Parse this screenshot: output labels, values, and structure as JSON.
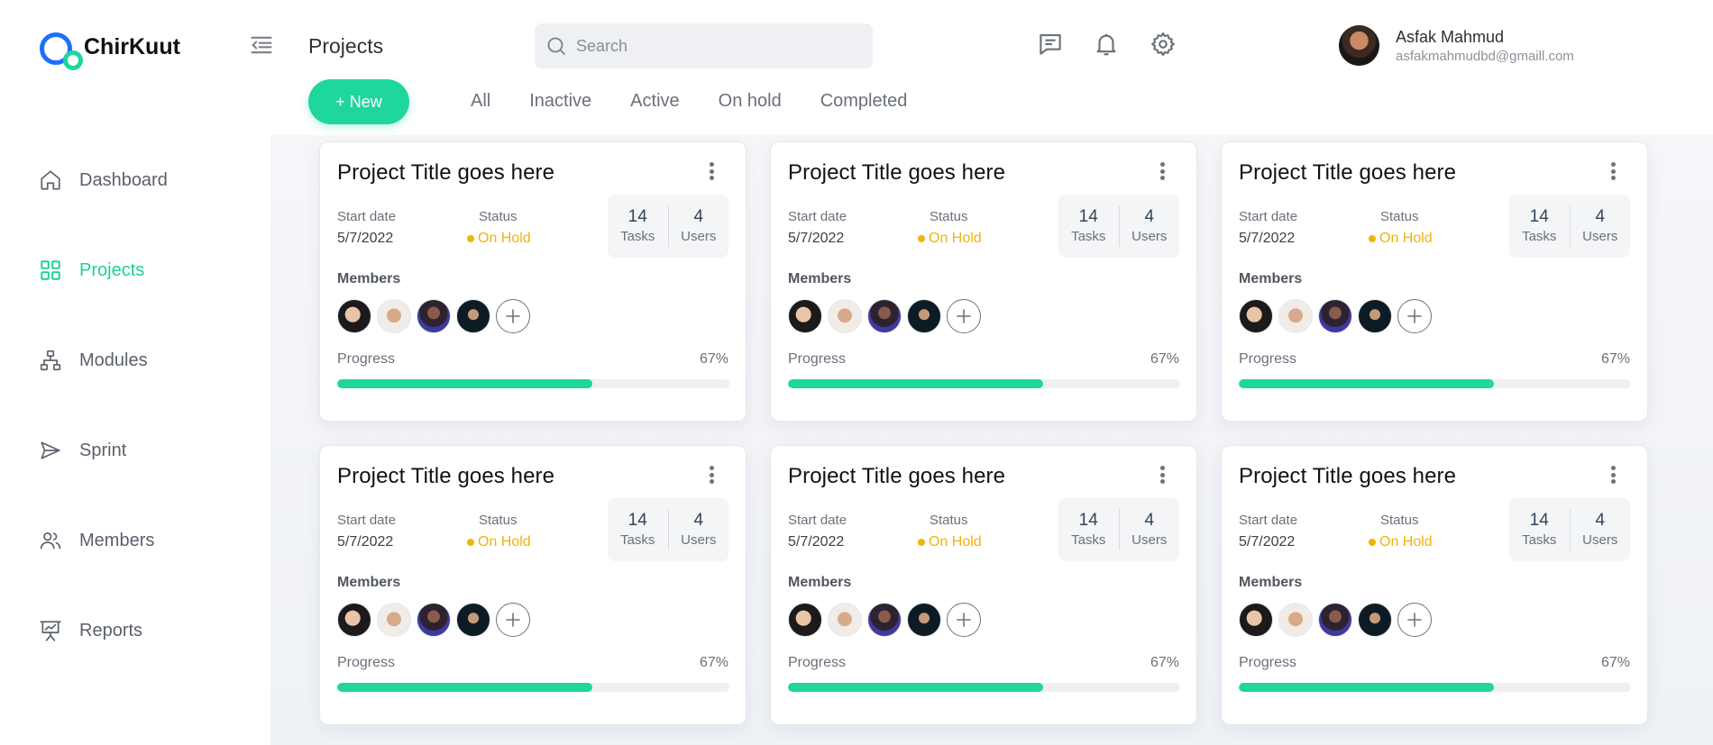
{
  "brand": {
    "name": "ChirKuut"
  },
  "sidebar": {
    "items": [
      {
        "label": "Dashboard",
        "icon": "home-icon",
        "active": false
      },
      {
        "label": "Projects",
        "icon": "grid-icon",
        "active": true
      },
      {
        "label": "Modules",
        "icon": "hierarchy-icon",
        "active": false
      },
      {
        "label": "Sprint",
        "icon": "send-icon",
        "active": false
      },
      {
        "label": "Members",
        "icon": "users-icon",
        "active": false
      },
      {
        "label": "Reports",
        "icon": "presentation-chart-icon",
        "active": false
      }
    ]
  },
  "header": {
    "title": "Projects",
    "search_placeholder": "Search",
    "user": {
      "name": "Asfak Mahmud",
      "email": "asfakmahmudbd@gmaill.com"
    }
  },
  "toolbar": {
    "new_label": "+ New",
    "filters": [
      "All",
      "Inactive",
      "Active",
      "On hold",
      "Completed"
    ]
  },
  "colors": {
    "accent": "#1fd69c",
    "status_on_hold": "#f2b20a",
    "brand_blue": "#1a6fff"
  },
  "cards": [
    {
      "title": "Project Title goes here",
      "start_label": "Start date",
      "start_date": "5/7/2022",
      "status_label": "Status",
      "status": "On Hold",
      "tasks": "14",
      "tasks_label": "Tasks",
      "users": "4",
      "users_label": "Users",
      "members_label": "Members",
      "progress_label": "Progress",
      "progress_text": "67%",
      "progress": 0.65
    },
    {
      "title": "Project Title goes here",
      "start_label": "Start date",
      "start_date": "5/7/2022",
      "status_label": "Status",
      "status": "On Hold",
      "tasks": "14",
      "tasks_label": "Tasks",
      "users": "4",
      "users_label": "Users",
      "members_label": "Members",
      "progress_label": "Progress",
      "progress_text": "67%",
      "progress": 0.65
    },
    {
      "title": "Project Title goes here",
      "start_label": "Start date",
      "start_date": "5/7/2022",
      "status_label": "Status",
      "status": "On Hold",
      "tasks": "14",
      "tasks_label": "Tasks",
      "users": "4",
      "users_label": "Users",
      "members_label": "Members",
      "progress_label": "Progress",
      "progress_text": "67%",
      "progress": 0.65
    },
    {
      "title": "Project Title goes here",
      "start_label": "Start date",
      "start_date": "5/7/2022",
      "status_label": "Status",
      "status": "On Hold",
      "tasks": "14",
      "tasks_label": "Tasks",
      "users": "4",
      "users_label": "Users",
      "members_label": "Members",
      "progress_label": "Progress",
      "progress_text": "67%",
      "progress": 0.65
    },
    {
      "title": "Project Title goes here",
      "start_label": "Start date",
      "start_date": "5/7/2022",
      "status_label": "Status",
      "status": "On Hold",
      "tasks": "14",
      "tasks_label": "Tasks",
      "users": "4",
      "users_label": "Users",
      "members_label": "Members",
      "progress_label": "Progress",
      "progress_text": "67%",
      "progress": 0.65
    },
    {
      "title": "Project Title goes here",
      "start_label": "Start date",
      "start_date": "5/7/2022",
      "status_label": "Status",
      "status": "On Hold",
      "tasks": "14",
      "tasks_label": "Tasks",
      "users": "4",
      "users_label": "Users",
      "members_label": "Members",
      "progress_label": "Progress",
      "progress_text": "67%",
      "progress": 0.65
    }
  ]
}
